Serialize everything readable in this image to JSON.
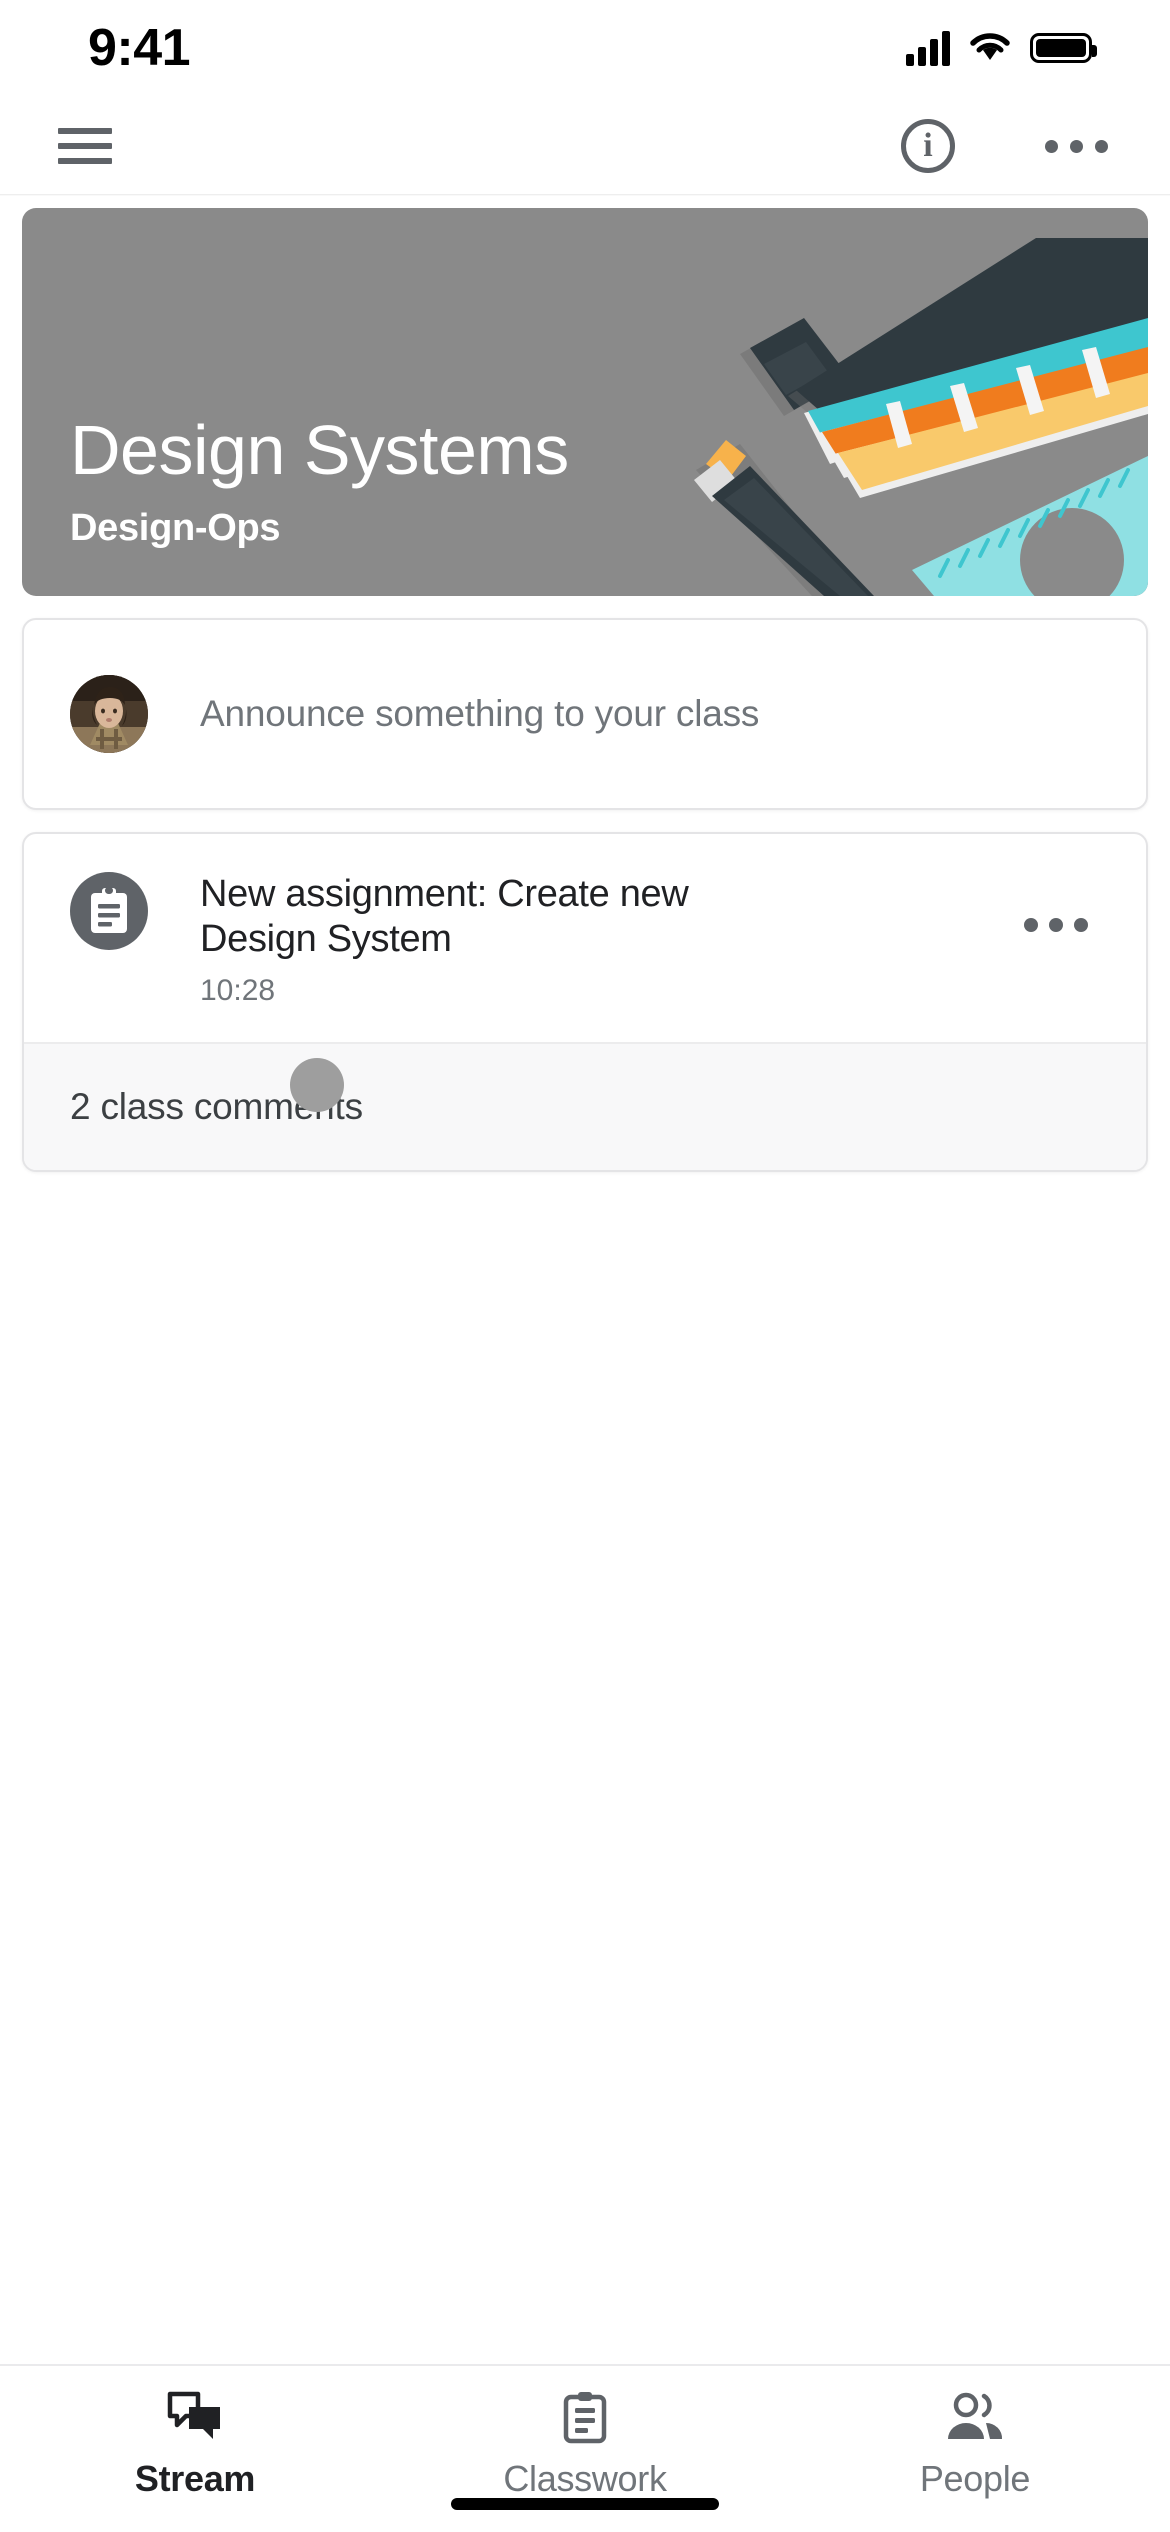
{
  "status_bar": {
    "time": "9:41",
    "signal_icon": "cellular-signal-icon",
    "wifi_icon": "wifi-icon",
    "battery_icon": "battery-full-icon"
  },
  "app_bar": {
    "menu_icon": "hamburger-menu-icon",
    "info_icon": "info-circle-icon",
    "info_glyph": "i",
    "overflow_icon": "more-horizontal-icon"
  },
  "hero": {
    "title": "Design Systems",
    "subtitle": "Design-Ops",
    "background_color": "#8a8a8a",
    "artwork": "design-tools-illustration",
    "art_colors": {
      "dark": "#2f3a40",
      "teal": "#3ec6cf",
      "teal_light": "#8fe0e3",
      "orange": "#f07c1e",
      "orange_light": "#f7b24b",
      "yellow": "#f9c96b",
      "white": "#f1f1f1"
    }
  },
  "announcement": {
    "avatar_name": "user-avatar",
    "placeholder": "Announce something to your class"
  },
  "assignment": {
    "icon_name": "assignment-clipboard-icon",
    "icon_bg": "#5f6368",
    "title": "New assignment: Create new Design System",
    "time": "10:28",
    "overflow_icon": "more-horizontal-icon",
    "comments_label": "2 class comments",
    "cursor_indicator": "touch-cursor-dot"
  },
  "bottom_nav": {
    "tabs": [
      {
        "label": "Stream",
        "icon": "chat-bubbles-icon",
        "active": true
      },
      {
        "label": "Classwork",
        "icon": "clipboard-icon",
        "active": false
      },
      {
        "label": "People",
        "icon": "people-icon",
        "active": false
      }
    ]
  },
  "home_indicator": "home-indicator-bar"
}
